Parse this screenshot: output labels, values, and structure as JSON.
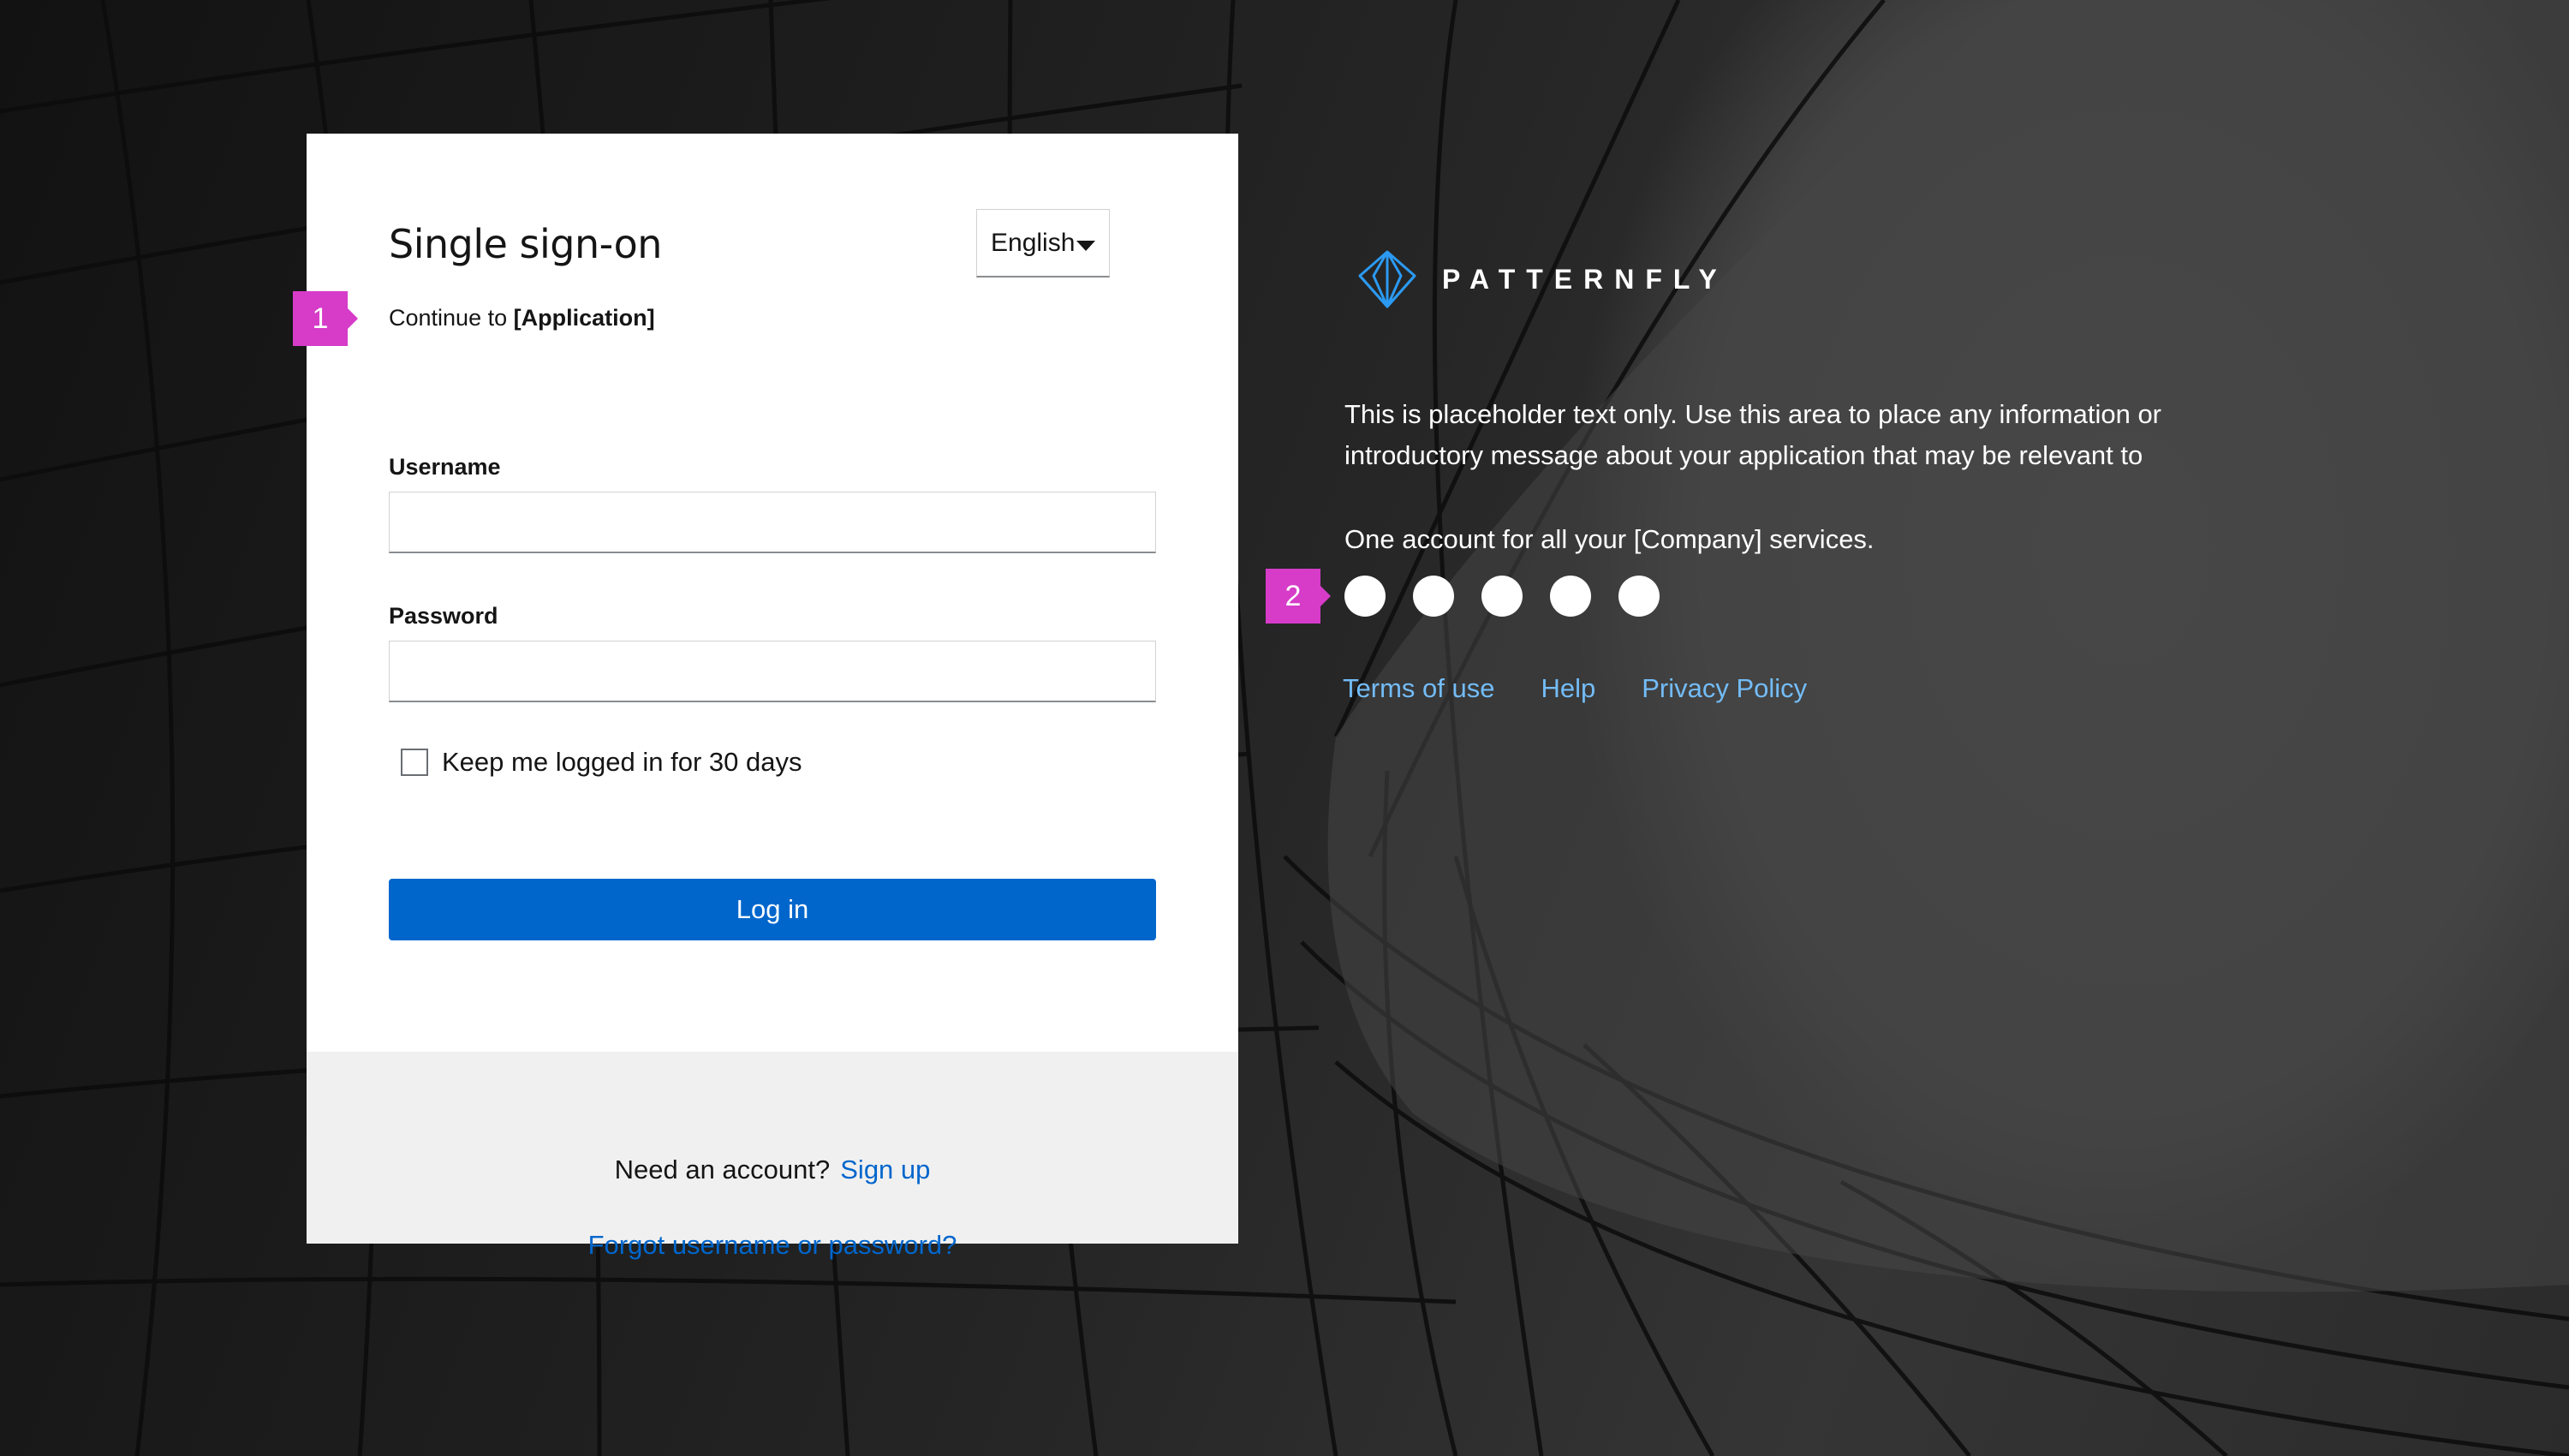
{
  "login": {
    "title": "Single sign-on",
    "subtitle_prefix": "Continue to",
    "subtitle_app": "[Application]",
    "language": "English",
    "username_label": "Username",
    "username_value": "",
    "password_label": "Password",
    "password_value": "",
    "remember_label": "Keep me logged in for 30 days",
    "remember_checked": false,
    "login_button": "Log in"
  },
  "footer": {
    "need_account": "Need an account?",
    "signup_link": "Sign up",
    "forgot_link": "Forgot username or password?"
  },
  "markers": [
    "1",
    "2"
  ],
  "brand": {
    "name": "PATTERNFLY",
    "icon": "patternfly-logo-icon"
  },
  "info": {
    "intro_text": "This is placeholder text only. Use this area to place any information or introductory message about your application that may be relevant to",
    "tagline": "One account for all your [Company] services.",
    "social_icons": [
      "social-icon-1",
      "social-icon-2",
      "social-icon-3",
      "social-icon-4",
      "social-icon-5"
    ],
    "links": [
      "Terms of use",
      "Help",
      "Privacy Policy"
    ]
  },
  "colors": {
    "primary": "#0066cc",
    "link_dark_bg": "#73bcf7",
    "annotation": "#d63cc8",
    "brand_accent": "#2b9af3"
  }
}
